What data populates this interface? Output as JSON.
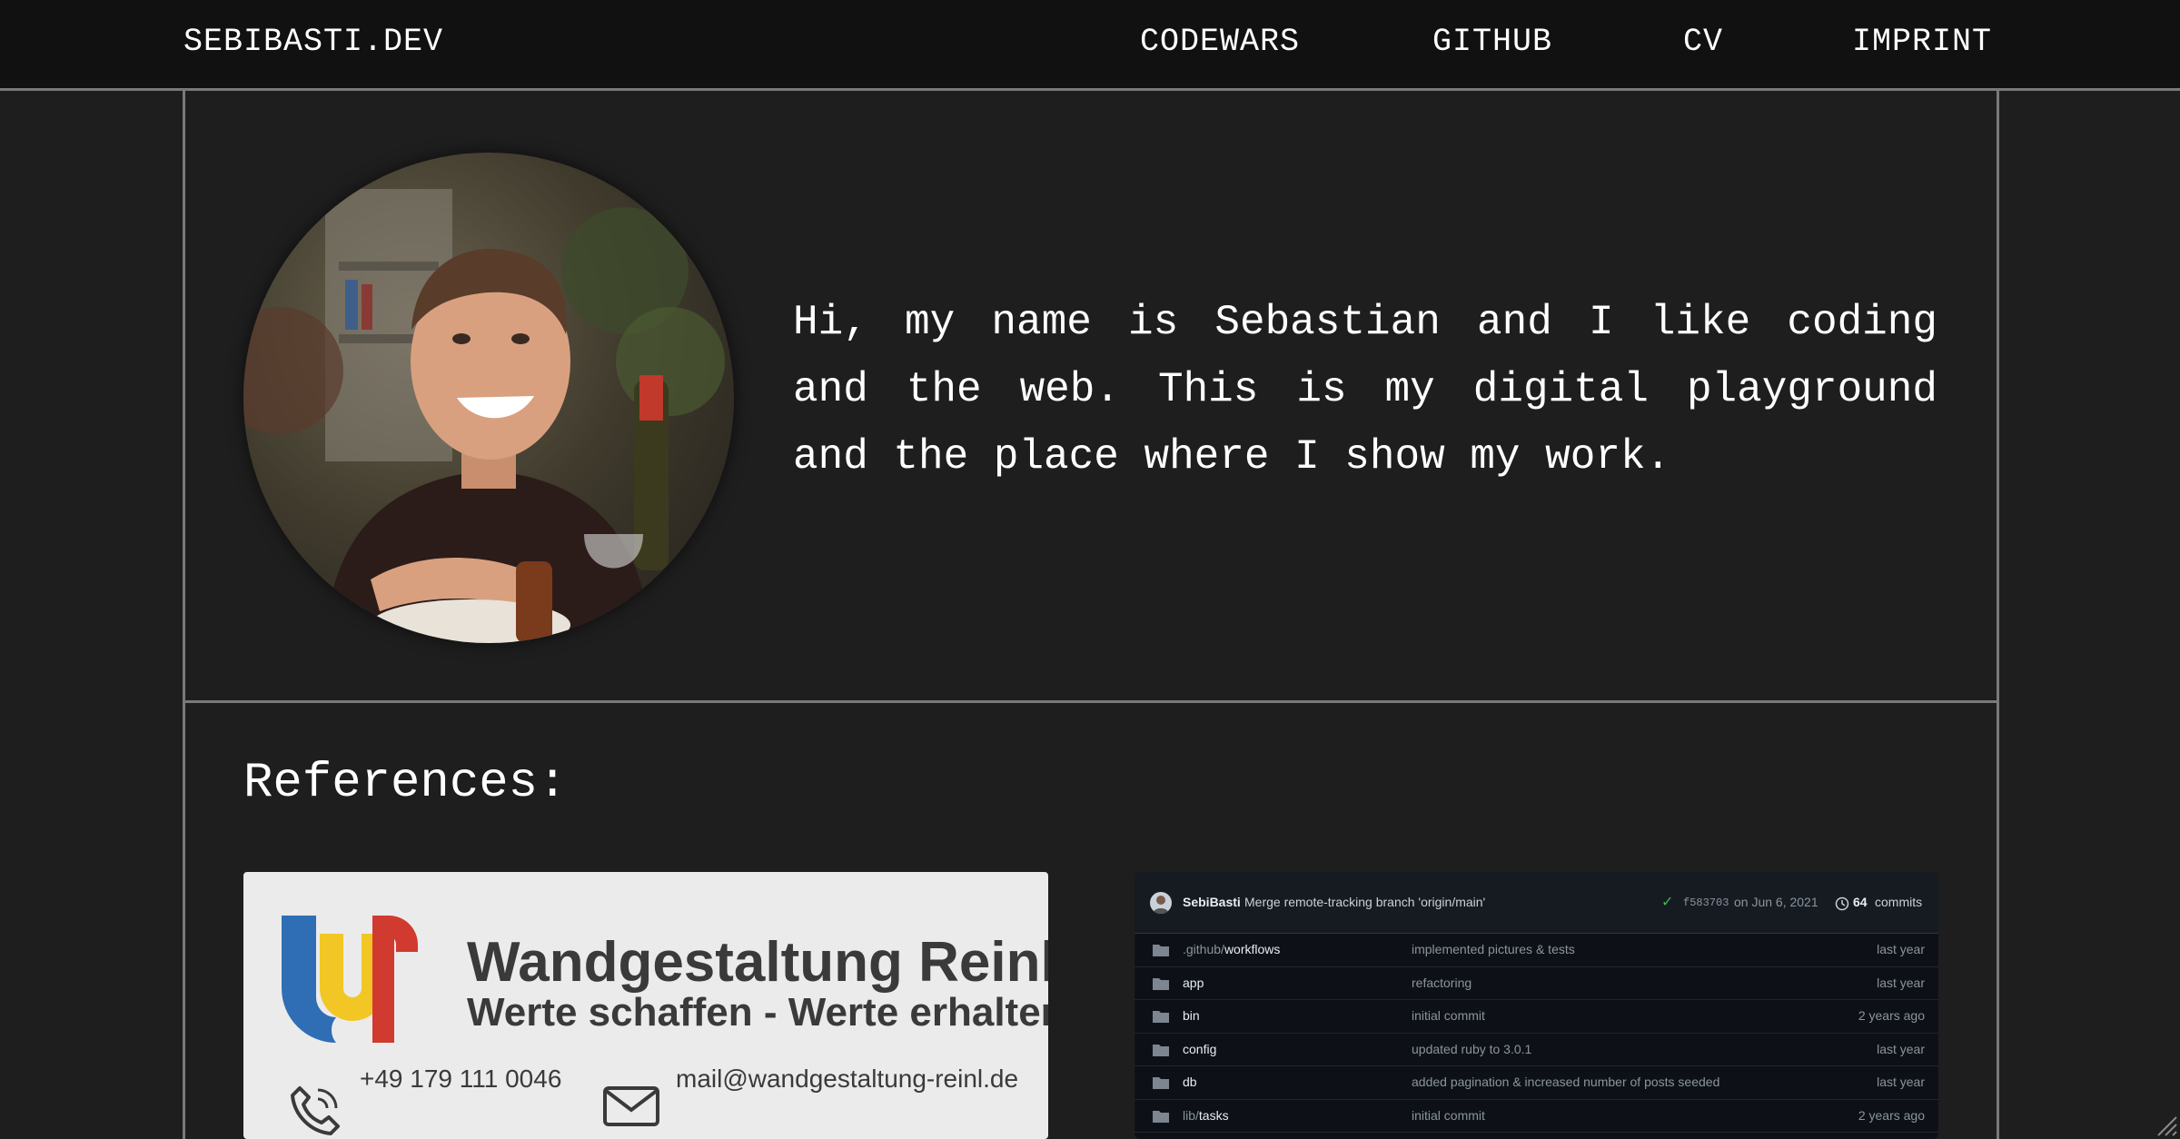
{
  "nav": {
    "brand": "SEBIBASTI.DEV",
    "links": [
      "CODEWARS",
      "GITHUB",
      "CV",
      "IMPRINT"
    ]
  },
  "intro": {
    "text": "Hi, my name is Sebastian and I like coding and the web. This is my digital playground and the place where I show my work."
  },
  "references": {
    "title": "References:",
    "wandgestaltung": {
      "name": "Wandgestaltung Reinl",
      "slogan": "Werte schaffen - Werte erhalten",
      "phone": "+49 179 111 0046",
      "email": "mail@wandgestaltung-reinl.de",
      "colors": {
        "blue": "#2f6eb5",
        "yellow": "#f2c41a",
        "red": "#d13a2f"
      }
    },
    "github": {
      "user": "SebiBasti",
      "message": "Merge remote-tracking branch 'origin/main'",
      "hash": "f583703",
      "date": "on Jun 6, 2021",
      "count": "64",
      "commits_label": "commits",
      "rows": [
        {
          "dir": ".github/",
          "name": "workflows",
          "msg": "implemented pictures & tests",
          "time": "last year"
        },
        {
          "dir": "",
          "name": "app",
          "msg": "refactoring",
          "time": "last year"
        },
        {
          "dir": "",
          "name": "bin",
          "msg": "initial commit",
          "time": "2 years ago"
        },
        {
          "dir": "",
          "name": "config",
          "msg": "updated ruby to 3.0.1",
          "time": "last year"
        },
        {
          "dir": "",
          "name": "db",
          "msg": "added pagination & increased number of posts seeded",
          "time": "last year"
        },
        {
          "dir": "lib/",
          "name": "tasks",
          "msg": "initial commit",
          "time": "2 years ago"
        }
      ]
    }
  }
}
